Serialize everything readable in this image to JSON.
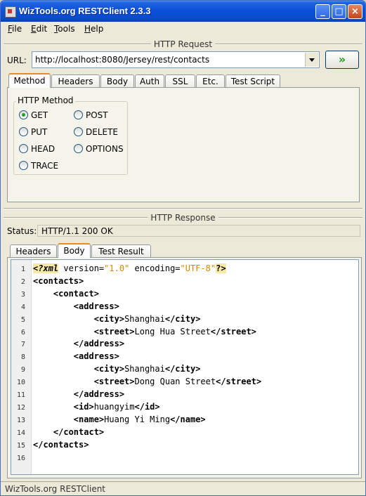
{
  "window": {
    "title": "WizTools.org RESTClient 2.3.3",
    "minimize": "_",
    "maximize": "□",
    "close": "×"
  },
  "menu": {
    "file": {
      "first": "F",
      "rest": "ile"
    },
    "edit": {
      "first": "E",
      "rest": "dit"
    },
    "tools": {
      "first": "T",
      "rest": "ools"
    },
    "help": {
      "first": "H",
      "rest": "elp"
    }
  },
  "request": {
    "section_title": "HTTP Request",
    "url_label": "URL:",
    "url_value": "http://localhost:8080/Jersey/rest/contacts",
    "go_glyph": "»",
    "tabs": [
      "Method",
      "Headers",
      "Body",
      "Auth",
      "SSL",
      "Etc.",
      "Test Script"
    ],
    "active_tab": "Method",
    "method_group_label": "HTTP Method",
    "methods": [
      "GET",
      "POST",
      "PUT",
      "DELETE",
      "HEAD",
      "OPTIONS",
      "TRACE"
    ],
    "selected_method": "GET"
  },
  "response": {
    "section_title": "HTTP Response",
    "status_label": "Status:",
    "status_value": "HTTP/1.1 200 OK",
    "tabs": [
      "Headers",
      "Body",
      "Test Result"
    ],
    "active_tab": "Body",
    "line_numbers": [
      "1",
      "2",
      "3",
      "4",
      "5",
      "6",
      "7",
      "8",
      "9",
      "10",
      "11",
      "12",
      "13",
      "14",
      "15",
      "16"
    ],
    "body_lines": [
      {
        "indent": "",
        "parts": [
          {
            "t": "<?xml",
            "c": "decl"
          },
          {
            "t": " version=",
            "c": ""
          },
          {
            "t": "\"1.0\"",
            "c": "attr-val"
          },
          {
            "t": " encoding=",
            "c": ""
          },
          {
            "t": "\"UTF-8\"",
            "c": "attr-val"
          },
          {
            "t": "?>",
            "c": "mark"
          }
        ]
      },
      {
        "indent": "",
        "parts": [
          {
            "t": "<contacts>",
            "c": "tag"
          }
        ]
      },
      {
        "indent": "    ",
        "parts": [
          {
            "t": "<contact>",
            "c": "tag"
          }
        ]
      },
      {
        "indent": "        ",
        "parts": [
          {
            "t": "<address>",
            "c": "tag"
          }
        ]
      },
      {
        "indent": "            ",
        "parts": [
          {
            "t": "<city>",
            "c": "tag"
          },
          {
            "t": "Shanghai",
            "c": ""
          },
          {
            "t": "</city>",
            "c": "tag"
          }
        ]
      },
      {
        "indent": "            ",
        "parts": [
          {
            "t": "<street>",
            "c": "tag"
          },
          {
            "t": "Long Hua Street",
            "c": ""
          },
          {
            "t": "</street>",
            "c": "tag"
          }
        ]
      },
      {
        "indent": "        ",
        "parts": [
          {
            "t": "</address>",
            "c": "tag"
          }
        ]
      },
      {
        "indent": "        ",
        "parts": [
          {
            "t": "<address>",
            "c": "tag"
          }
        ]
      },
      {
        "indent": "            ",
        "parts": [
          {
            "t": "<city>",
            "c": "tag"
          },
          {
            "t": "Shanghai",
            "c": ""
          },
          {
            "t": "</city>",
            "c": "tag"
          }
        ]
      },
      {
        "indent": "            ",
        "parts": [
          {
            "t": "<street>",
            "c": "tag"
          },
          {
            "t": "Dong Quan Street",
            "c": ""
          },
          {
            "t": "</street>",
            "c": "tag"
          }
        ]
      },
      {
        "indent": "        ",
        "parts": [
          {
            "t": "</address>",
            "c": "tag"
          }
        ]
      },
      {
        "indent": "        ",
        "parts": [
          {
            "t": "<id>",
            "c": "tag"
          },
          {
            "t": "huangyim",
            "c": ""
          },
          {
            "t": "</id>",
            "c": "tag"
          }
        ]
      },
      {
        "indent": "        ",
        "parts": [
          {
            "t": "<name>",
            "c": "tag"
          },
          {
            "t": "Huang Yi Ming",
            "c": ""
          },
          {
            "t": "</name>",
            "c": "tag"
          }
        ]
      },
      {
        "indent": "    ",
        "parts": [
          {
            "t": "</contact>",
            "c": "tag"
          }
        ]
      },
      {
        "indent": "",
        "parts": [
          {
            "t": "</contacts>",
            "c": "tag"
          }
        ]
      },
      {
        "indent": "",
        "parts": []
      }
    ]
  },
  "statusbar": {
    "text": "WizTools.org RESTClient"
  },
  "colors": {
    "title_bar": "#0a50d8",
    "active_tab_accent": "#e68b2c",
    "radio_selected": "#21a121",
    "attr_value": "#d88a00"
  },
  "icons": {
    "app": "restclient-app-icon",
    "go": "double-chevron-right-icon",
    "dropdown": "chevron-down-icon"
  }
}
